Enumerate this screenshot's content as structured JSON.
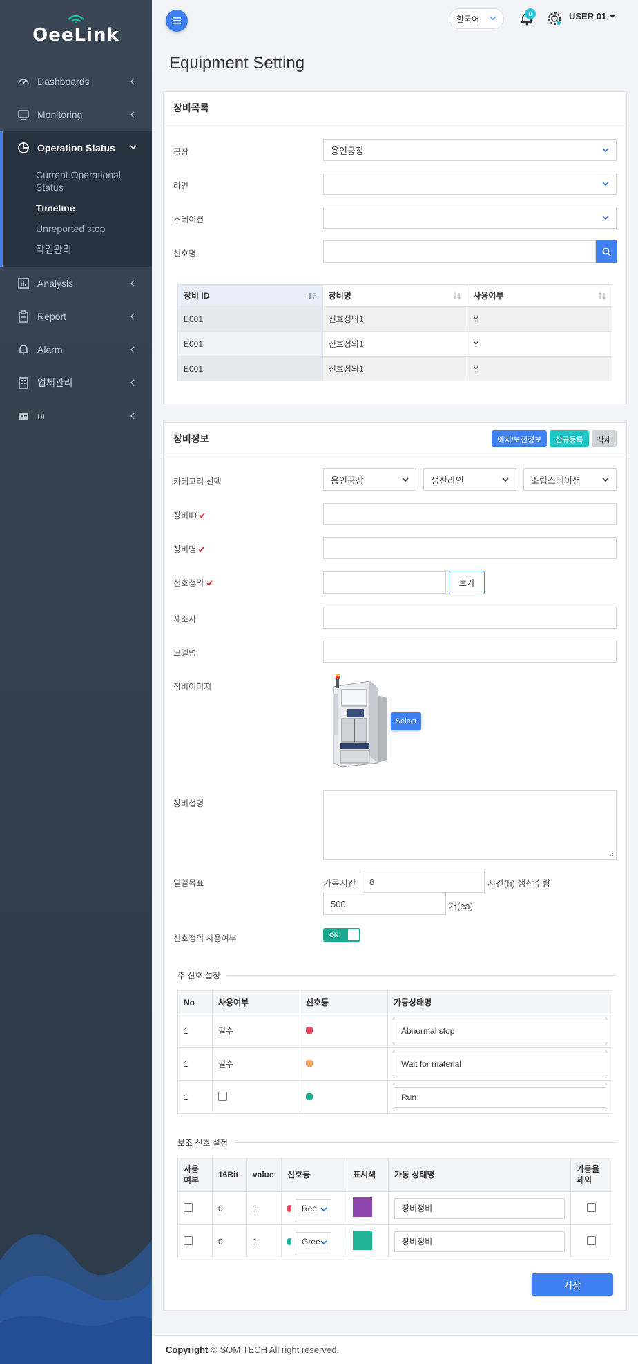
{
  "app": {
    "logo": "OeeLink"
  },
  "sidebar": {
    "items": [
      {
        "label": "Dashboards",
        "icon": "gauge-icon"
      },
      {
        "label": "Monitoring",
        "icon": "monitor-icon"
      },
      {
        "label": "Operation Status",
        "icon": "pie-chart-icon"
      },
      {
        "label": "Analysis",
        "icon": "bar-chart-icon"
      },
      {
        "label": "Report",
        "icon": "clipboard-icon"
      },
      {
        "label": "Alarm",
        "icon": "bell-icon"
      },
      {
        "label": "업체관리",
        "icon": "building-icon"
      },
      {
        "label": "ui",
        "icon": "id-badge-icon"
      }
    ],
    "sub_items": [
      "Current Operational Status",
      "Timeline",
      "Unreported stop",
      "작업관리"
    ],
    "active_sub": "Timeline"
  },
  "topbar": {
    "language": "한국어",
    "notification_count": "0",
    "user": "USER 01"
  },
  "page_title": "Equipment Setting",
  "equipment_list": {
    "title": "장비목록",
    "filters": [
      {
        "label": "공장",
        "value": "용인공장"
      },
      {
        "label": "라인",
        "value": ""
      },
      {
        "label": "스테이션",
        "value": ""
      },
      {
        "label": "신호명",
        "value": ""
      }
    ],
    "columns": [
      "장비 ID",
      "장비명",
      "사용여부"
    ],
    "rows": [
      [
        "E001",
        "신호정의1",
        "Y"
      ],
      [
        "E001",
        "신호정의1",
        "Y"
      ],
      [
        "E001",
        "신호정의1",
        "Y"
      ]
    ]
  },
  "equipment_info": {
    "title": "장비정보",
    "buttons": {
      "maintenance": "예지/보전정보",
      "new": "신규등록",
      "delete": "삭제"
    },
    "category_label": "카테고리 선택",
    "category": [
      "용인공장",
      "생산라인",
      "조립스테이션"
    ],
    "labels": {
      "equipment_id": "장비ID",
      "equipment_name": "장비명",
      "signal_def": "신호정의",
      "maker": "제조사",
      "model": "모델명",
      "image": "장비이미지",
      "description": "장비설명",
      "daily_target": "일일목표",
      "signal_use": "신호정의 사용여부"
    },
    "view_button": "보기",
    "select_button": "Select",
    "daily_target": {
      "hours_label": "가동시간",
      "hours_value": "8",
      "hours_unit": "시간(h) 생산수량",
      "qty_value": "500",
      "qty_unit": "개(ea)"
    },
    "toggle": "ON"
  },
  "main_signal": {
    "title": "주 신호 설정",
    "columns": [
      "No",
      "사용여부",
      "신호등",
      "가동상태명"
    ],
    "rows": [
      {
        "no": "1",
        "use": "필수",
        "color": "#e5475e",
        "state": "Abnormal stop"
      },
      {
        "no": "1",
        "use": "필수",
        "color": "#f5a55c",
        "state": "Wait for material"
      },
      {
        "no": "1",
        "use": "",
        "color": "#1fb096",
        "state": "Run"
      }
    ]
  },
  "aux_signal": {
    "title": "보조 신호 설정",
    "columns": [
      "사용 여부",
      "16Bit",
      "value",
      "신호등",
      "표시색",
      "가동 상태명",
      "가동율 제외"
    ],
    "rows": [
      {
        "bit": "0",
        "value": "1",
        "light_color": "#e5475e",
        "light": "Red",
        "display_color": "#8e44ad",
        "state": "장비정비"
      },
      {
        "bit": "0",
        "value": "1",
        "light_color": "#1fb096",
        "light": "Gree",
        "display_color": "#1fb596",
        "state": "장비정비"
      }
    ]
  },
  "save_button": "저장",
  "footer": {
    "copyright": "Copyright",
    "text": "© SOM TECH All right reserved."
  }
}
